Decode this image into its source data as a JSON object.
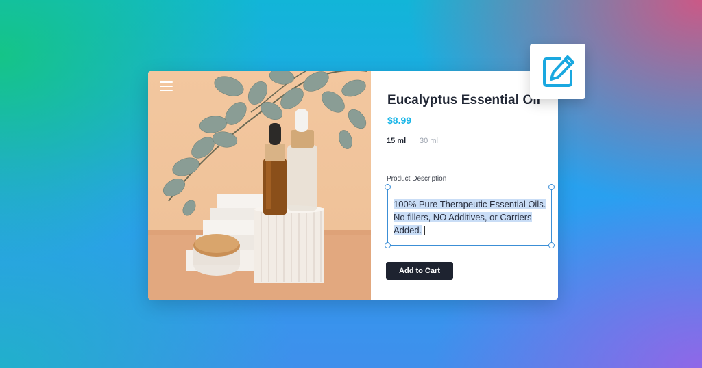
{
  "product": {
    "title": "Eucalyptus Essential Oil",
    "price": "$8.99",
    "sizes": [
      "15 ml",
      "30 ml"
    ],
    "selected_size": "15 ml",
    "description_label": "Product Description",
    "description_lines": [
      "100% Pure Therapeutic Essential Oils.",
      "No fillers, NO Additives, or Carriers",
      "Added."
    ],
    "add_to_cart_label": "Add to Cart"
  },
  "icons": {
    "menu": "hamburger-menu-icon",
    "edit": "edit-pencil-icon"
  },
  "colors": {
    "price_accent": "#1ab6e8",
    "selection_highlight": "#c9ddf6",
    "text_box_border": "#3c8fd6",
    "button_bg": "#1e2330",
    "edit_icon": "#1aa8e0"
  }
}
